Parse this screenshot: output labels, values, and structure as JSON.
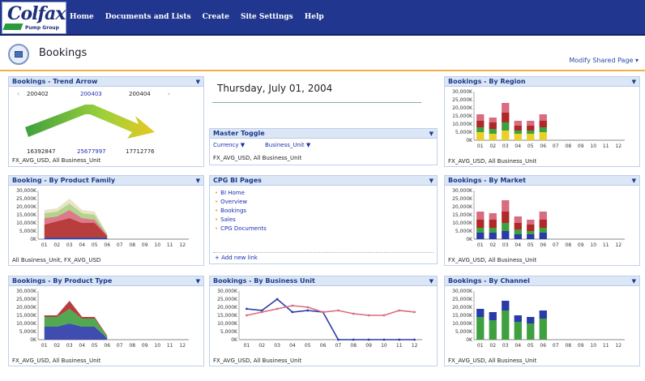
{
  "logo": {
    "main": "Colfax",
    "sub": "Pump Group"
  },
  "nav": [
    "Home",
    "Documents and Lists",
    "Create",
    "Site Settings",
    "Help"
  ],
  "page": {
    "title": "Bookings",
    "modify": "Modify Shared Page ▾"
  },
  "date": "Thursday, July 01, 2004",
  "trend": {
    "title": "Bookings - Trend Arrow",
    "periods": [
      "200402",
      "200403",
      "200404"
    ],
    "values": [
      "16392847",
      "25677997",
      "17712776"
    ],
    "caption": "FX_AVG_USD, All Business_Unit"
  },
  "master": {
    "title": "Master Toggle",
    "currency": "Currency",
    "bu": "Business_Unit",
    "caption": "FX_AVG_USD, All Business_Unit"
  },
  "cpg": {
    "title": "CPG BI Pages",
    "links": [
      "BI Home",
      "Overview",
      "Bookings",
      "Sales",
      "CPG Documents"
    ],
    "add": "Add new link"
  },
  "colors": {
    "green": "#3fa03f",
    "red": "#b02828",
    "blue": "#2a3aa8",
    "yellow": "#e8d028",
    "pink": "#d86c80"
  },
  "panels": [
    {
      "key": "region",
      "title": "Bookings - By Region",
      "caption": "FX_AVG_USD, All Business_Unit"
    },
    {
      "key": "market",
      "title": "Bookings - By Market",
      "caption": "FX_AVG_USD, All Business_Unit"
    },
    {
      "key": "channel",
      "title": "Bookings - By Channel",
      "caption": "FX_AVG_USD, All Business_Unit"
    },
    {
      "key": "family",
      "title": "Booking - By Product Family",
      "caption": "All Business_Unit, FX_AVG_USD"
    },
    {
      "key": "type",
      "title": "Bookings - By Product Type",
      "caption": "FX_AVG_USD, All Business_Unit"
    },
    {
      "key": "bu",
      "title": "Bookings - By Business Unit",
      "caption": "FX_AVG_USD, All Business_Unit"
    }
  ],
  "chart_data": [
    {
      "type": "bar",
      "id": "region",
      "categories": [
        "01",
        "02",
        "03",
        "04",
        "05",
        "06",
        "07",
        "08",
        "09",
        "10",
        "11",
        "12"
      ],
      "ylabels": [
        "30,000K",
        "25,000K",
        "20,000K",
        "15,000K",
        "10,000K",
        "5,000K",
        "0K"
      ],
      "ylim": [
        0,
        30000
      ],
      "series": [
        {
          "values": [
            5000,
            4000,
            6000,
            4000,
            4000,
            5000,
            0,
            0,
            0,
            0,
            0,
            0
          ]
        },
        {
          "values": [
            3000,
            3000,
            5000,
            2000,
            2000,
            3000,
            0,
            0,
            0,
            0,
            0,
            0
          ]
        },
        {
          "values": [
            4000,
            4000,
            6000,
            3000,
            3000,
            4000,
            0,
            0,
            0,
            0,
            0,
            0
          ]
        },
        {
          "values": [
            4000,
            3000,
            6000,
            3000,
            3000,
            4000,
            0,
            0,
            0,
            0,
            0,
            0
          ]
        }
      ]
    },
    {
      "type": "bar",
      "id": "market",
      "categories": [
        "01",
        "02",
        "03",
        "04",
        "05",
        "06",
        "07",
        "08",
        "09",
        "10",
        "11",
        "12"
      ],
      "ylabels": [
        "30,000K",
        "25,000K",
        "20,000K",
        "15,000K",
        "10,000K",
        "5,000K",
        "0K"
      ],
      "ylim": [
        0,
        30000
      ],
      "series": [
        {
          "values": [
            4000,
            4000,
            5000,
            3000,
            3000,
            4000,
            0,
            0,
            0,
            0,
            0,
            0
          ]
        },
        {
          "values": [
            3000,
            3000,
            5000,
            3000,
            2000,
            3000,
            0,
            0,
            0,
            0,
            0,
            0
          ]
        },
        {
          "values": [
            5000,
            5000,
            7000,
            4000,
            4000,
            5000,
            0,
            0,
            0,
            0,
            0,
            0
          ]
        },
        {
          "values": [
            5000,
            4000,
            7000,
            4000,
            3000,
            5000,
            0,
            0,
            0,
            0,
            0,
            0
          ]
        }
      ]
    },
    {
      "type": "bar",
      "id": "channel",
      "categories": [
        "01",
        "02",
        "03",
        "04",
        "05",
        "06",
        "07",
        "08",
        "09",
        "10",
        "11",
        "12"
      ],
      "ylabels": [
        "30,000K",
        "25,000K",
        "20,000K",
        "15,000K",
        "10,000K",
        "5,000K",
        "0K"
      ],
      "ylim": [
        0,
        30000
      ],
      "series": [
        {
          "values": [
            14000,
            12000,
            18000,
            11000,
            10000,
            13000,
            0,
            0,
            0,
            0,
            0,
            0
          ]
        },
        {
          "values": [
            5000,
            5000,
            6000,
            4000,
            4000,
            5000,
            0,
            0,
            0,
            0,
            0,
            0
          ]
        }
      ]
    },
    {
      "type": "area",
      "id": "family",
      "categories": [
        "01",
        "02",
        "03",
        "04",
        "05",
        "06",
        "07",
        "08",
        "09",
        "10",
        "11",
        "12"
      ],
      "ylabels": [
        "30,000K",
        "25,000K",
        "20,000K",
        "15,000K",
        "10,000K",
        "5,000K",
        "0K"
      ],
      "ylim": [
        0,
        30000
      ],
      "series": [
        {
          "values": [
            1000,
            1000,
            1000,
            1000,
            1000,
            1000
          ]
        },
        {
          "values": [
            8000,
            10000,
            12000,
            9000,
            9000,
            1000
          ]
        },
        {
          "values": [
            4000,
            3000,
            5000,
            3000,
            2000,
            500
          ]
        },
        {
          "values": [
            3000,
            3000,
            4000,
            3000,
            3000,
            500
          ]
        },
        {
          "values": [
            2000,
            2000,
            3000,
            2000,
            2000,
            500
          ]
        }
      ]
    },
    {
      "type": "area",
      "id": "type",
      "categories": [
        "01",
        "02",
        "03",
        "04",
        "05",
        "06",
        "07",
        "08",
        "09",
        "10",
        "11",
        "12"
      ],
      "ylabels": [
        "30,000K",
        "25,000K",
        "20,000K",
        "15,000K",
        "10,000K",
        "5,000K",
        "0K"
      ],
      "ylim": [
        0,
        30000
      ],
      "series": [
        {
          "values": [
            8000,
            8000,
            10000,
            8000,
            8000,
            1000
          ]
        },
        {
          "values": [
            6000,
            6000,
            9000,
            5000,
            5000,
            1000
          ]
        },
        {
          "values": [
            1000,
            1000,
            5000,
            1000,
            1000,
            500
          ]
        }
      ]
    },
    {
      "type": "line",
      "id": "bu",
      "categories": [
        "01",
        "02",
        "03",
        "04",
        "05",
        "06",
        "07",
        "08",
        "09",
        "10",
        "11",
        "12"
      ],
      "ylabels": [
        "30,000K",
        "25,000K",
        "20,000K",
        "15,000K",
        "10,000K",
        "5,000K",
        "0K"
      ],
      "ylim": [
        0,
        30000
      ],
      "series": [
        {
          "values": [
            19000,
            18000,
            25000,
            17000,
            18000,
            17000,
            0,
            0,
            0,
            0,
            0,
            0
          ]
        },
        {
          "values": [
            15000,
            17000,
            19000,
            21000,
            20000,
            17000,
            18000,
            16000,
            15000,
            15000,
            18000,
            17000
          ]
        }
      ]
    }
  ]
}
